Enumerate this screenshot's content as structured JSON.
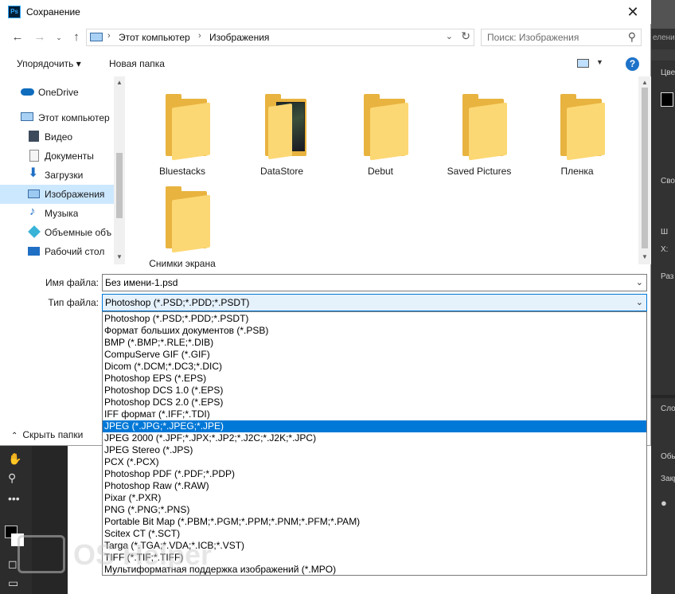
{
  "window": {
    "title": "Сохранение",
    "app_icon_text": "Ps"
  },
  "nav": {
    "breadcrumbs": [
      "Этот компьютер",
      "Изображения"
    ],
    "search_placeholder": "Поиск: Изображения"
  },
  "toolbar": {
    "organize_label": "Упорядочить ▾",
    "new_folder_label": "Новая папка"
  },
  "sidebar": {
    "items": [
      {
        "label": "OneDrive",
        "icon": "cloud-icon"
      },
      {
        "label": "Этот компьютер",
        "icon": "computer-icon"
      },
      {
        "label": "Видео",
        "icon": "video-icon"
      },
      {
        "label": "Документы",
        "icon": "documents-icon"
      },
      {
        "label": "Загрузки",
        "icon": "download-icon"
      },
      {
        "label": "Изображения",
        "icon": "pictures-icon",
        "selected": true
      },
      {
        "label": "Музыка",
        "icon": "music-icon"
      },
      {
        "label": "Объемные объ",
        "icon": "3d-objects-icon"
      },
      {
        "label": "Рабочий стол",
        "icon": "desktop-icon"
      }
    ]
  },
  "folders": [
    {
      "name": "Bluestacks"
    },
    {
      "name": "DataStore"
    },
    {
      "name": "Debut"
    },
    {
      "name": "Saved Pictures"
    },
    {
      "name": "Пленка"
    },
    {
      "name": "Снимки экрана"
    }
  ],
  "form": {
    "filename_label": "Имя файла:",
    "filename_value": "Без имени-1.psd",
    "filetype_label": "Тип файла:",
    "filetype_value": "Photoshop (*.PSD;*.PDD;*.PSDT)",
    "hide_folders_label": "Скрыть папки"
  },
  "filetype_options": [
    "Photoshop (*.PSD;*.PDD;*.PSDT)",
    "Формат больших документов (*.PSB)",
    "BMP (*.BMP;*.RLE;*.DIB)",
    "CompuServe GIF (*.GIF)",
    "Dicom (*.DCM;*.DC3;*.DIC)",
    "Photoshop EPS (*.EPS)",
    "Photoshop DCS 1.0 (*.EPS)",
    "Photoshop DCS 2.0 (*.EPS)",
    "IFF формат (*.IFF;*.TDI)",
    "JPEG (*.JPG;*.JPEG;*.JPE)",
    "JPEG 2000 (*.JPF;*.JPX;*.JP2;*.J2C;*.J2K;*.JPC)",
    "JPEG Stereo (*.JPS)",
    "PCX (*.PCX)",
    "Photoshop PDF (*.PDF;*.PDP)",
    "Photoshop Raw (*.RAW)",
    "Pixar (*.PXR)",
    "PNG (*.PNG;*.PNS)",
    "Portable Bit Map (*.PBM;*.PGM;*.PPM;*.PNM;*.PFM;*.PAM)",
    "Scitex CT (*.SCT)",
    "Targa (*.TGA;*.VDA;*.ICB;*.VST)",
    "TIFF (*.TIF;*.TIFF)",
    "Мультиформатная поддержка изображений  (*.MPO)"
  ],
  "selected_option_index": 9,
  "photoshop_panel": {
    "labels": [
      "Цве",
      "Сво",
      "Ш",
      "Х:",
      "Раз",
      "Сло",
      "Обы",
      "Закр"
    ],
    "truncated_tab": "еление"
  },
  "watermark": "OS Helper",
  "colors": {
    "selection": "#0078d7",
    "nav_selected": "#cce8ff",
    "folder": "#fcd874"
  }
}
